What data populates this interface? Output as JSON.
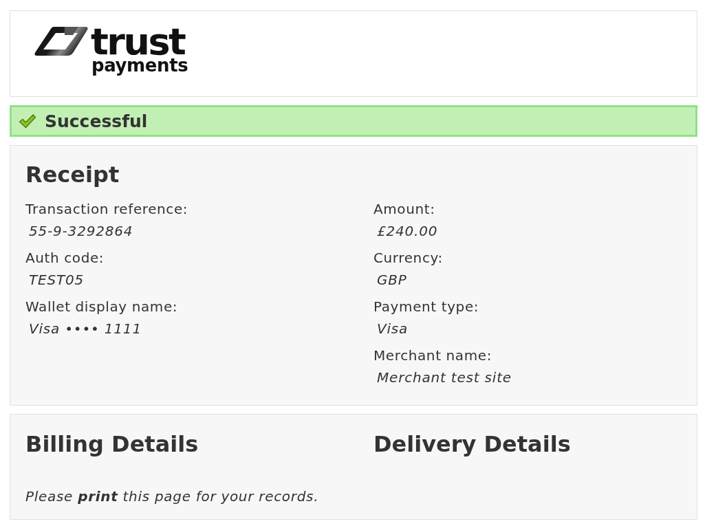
{
  "logo": {
    "wordmark": "trust",
    "tagline": "payments"
  },
  "status": {
    "kind": "success",
    "label": "Successful"
  },
  "receipt": {
    "title": "Receipt",
    "columns": [
      [
        {
          "label": "Transaction reference:",
          "value": "55-9-3292864"
        },
        {
          "label": "Auth code:",
          "value": "TEST05"
        },
        {
          "label": "Wallet display name:",
          "value": "Visa •••• 1111"
        }
      ],
      [
        {
          "label": "Amount:",
          "value": "£240.00"
        },
        {
          "label": "Currency:",
          "value": "GBP"
        },
        {
          "label": "Payment type:",
          "value": "Visa"
        },
        {
          "label": "Merchant name:",
          "value": "Merchant test site"
        }
      ]
    ]
  },
  "details": {
    "sections": [
      "Billing Details",
      "Delivery Details"
    ],
    "note": "Please **print** this page for your records."
  }
}
